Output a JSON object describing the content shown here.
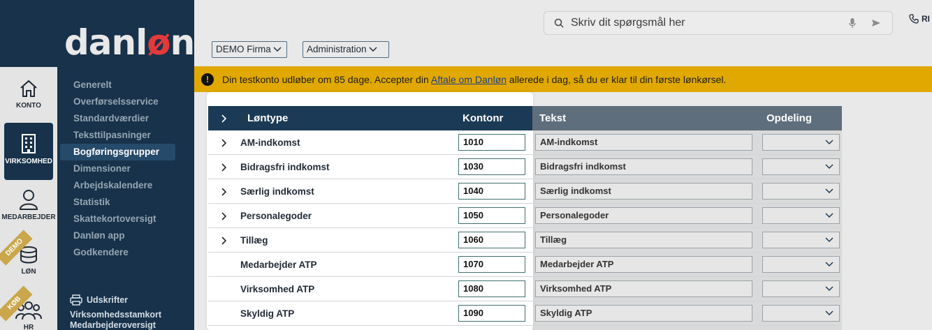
{
  "brand": {
    "logo_left": "danl",
    "logo_o": "ø",
    "logo_right": "n"
  },
  "rail": [
    {
      "label": "KONTO",
      "icon": "home-icon"
    },
    {
      "label": "VIRKSOMHED",
      "icon": "building-icon",
      "active": true
    },
    {
      "label": "MEDARBEJDER",
      "icon": "person-icon"
    },
    {
      "label": "LØN",
      "icon": "coins-icon",
      "ribbon": "DEMO"
    },
    {
      "label": "HR",
      "icon": "people-icon",
      "ribbon": "KØB"
    }
  ],
  "subnav": [
    "Generelt",
    "Overførselsservice",
    "Standardværdier",
    "Teksttilpasninger",
    "Bogføringsgrupper",
    "Dimensioner",
    "Arbejdskalendere",
    "Statistik",
    "Skattekortoversigt",
    "Danløn app",
    "Godkendere"
  ],
  "subnav_active": "Bogføringsgrupper",
  "prints": {
    "title": "Udskrifter",
    "links": [
      "Virksomhedsstamkort",
      "Medarbejderoversigt"
    ]
  },
  "search": {
    "placeholder": "Skriv dit spørgsmål her"
  },
  "ring_label": "RI",
  "dropdowns": {
    "company": "DEMO Firma",
    "role": "Administration"
  },
  "banner": {
    "before": "Din testkonto udløber om 85 dage. Accepter din ",
    "link": "Aftale om Danløn",
    "after": " allerede i dag, så du er klar til din første lønkørsel."
  },
  "table": {
    "headers": {
      "type": "Løntype",
      "konto": "Kontonr",
      "tekst": "Tekst",
      "opdeling": "Opdeling"
    },
    "rows": [
      {
        "name": "AM-indkomst",
        "konto": "1010",
        "tekst": "AM-indkomst",
        "expandable": true
      },
      {
        "name": "Bidragsfri indkomst",
        "konto": "1030",
        "tekst": "Bidragsfri indkomst",
        "expandable": true
      },
      {
        "name": "Særlig indkomst",
        "konto": "1040",
        "tekst": "Særlig indkomst",
        "expandable": true
      },
      {
        "name": "Personalegoder",
        "konto": "1050",
        "tekst": "Personalegoder",
        "expandable": true
      },
      {
        "name": "Tillæg",
        "konto": "1060",
        "tekst": "Tillæg",
        "expandable": true
      },
      {
        "name": "Medarbejder ATP",
        "konto": "1070",
        "tekst": "Medarbejder ATP",
        "expandable": false
      },
      {
        "name": "Virksomhed ATP",
        "konto": "1080",
        "tekst": "Virksomhed ATP",
        "expandable": false
      },
      {
        "name": "Skyldig ATP",
        "konto": "1090",
        "tekst": "Skyldig ATP",
        "expandable": false
      }
    ]
  },
  "colors": {
    "navy": "#17324a",
    "banner": "#e0a800",
    "accent_red": "#e23a3a"
  }
}
